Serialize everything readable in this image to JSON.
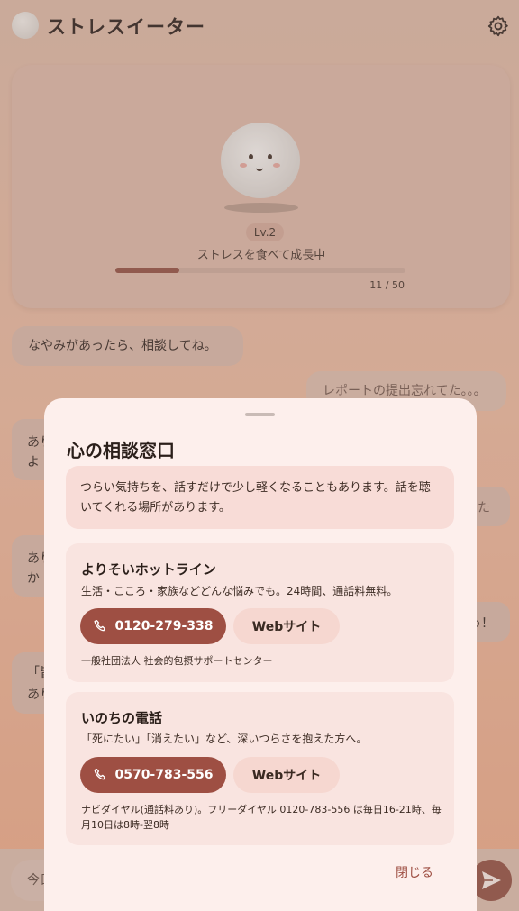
{
  "header": {
    "title": "ストレスイーター",
    "settings_icon": "gear-icon"
  },
  "pet": {
    "level": "Lv.2",
    "status": "ストレスを食べて成長中",
    "progress_label": "11 / 50",
    "progress_fraction": 0.22
  },
  "chat": {
    "bot_message": "なやみがあったら、相談してね。",
    "user_message": "レポートの提出忘れてた。。。",
    "fragments": [
      "あり",
      "よ",
      "た",
      "あり",
      "か",
      "っ！",
      "「皆",
      "あり"
    ]
  },
  "input": {
    "placeholder": "今日"
  },
  "modal": {
    "title": "心の相談窓口",
    "notice": "つらい気持ちを、話すだけで少し軽くなることもあります。話を聴いてくれる場所があります。",
    "resources": [
      {
        "name": "よりそいホットライン",
        "desc": "生活・こころ・家族などどんな悩みでも。24時間、通話料無料。",
        "phone": "0120-279-338",
        "web": "Webサイト",
        "org": "一般社団法人 社会的包摂サポートセンター"
      },
      {
        "name": "いのちの電話",
        "desc": "「死にたい」「消えたい」など、深いつらさを抱えた方へ。",
        "phone": "0570-783-556",
        "web": "Webサイト",
        "org": "ナビダイヤル(通話料あり)。フリーダイヤル 0120-783-556 は毎日16-21時、毎月10日は8時-翌8時"
      }
    ],
    "close": "閉じる"
  },
  "colors": {
    "accent": "#9e4f43",
    "modal_bg": "#fdefec",
    "card_bg": "#f9e4e0"
  }
}
